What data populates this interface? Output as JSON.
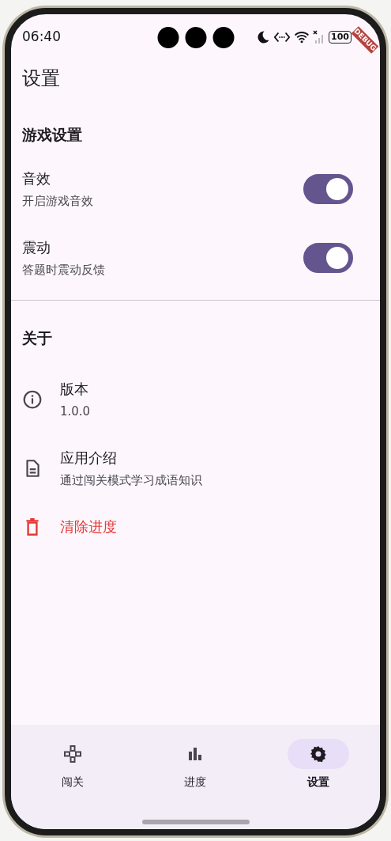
{
  "status_bar": {
    "time": "06:40",
    "battery": "100"
  },
  "debug_banner": "DEBUG",
  "app_bar": {
    "title": "设置"
  },
  "sections": [
    {
      "header": "游戏设置",
      "items": [
        {
          "kind": "switch",
          "title": "音效",
          "subtitle": "开启游戏音效",
          "on": true
        },
        {
          "kind": "switch",
          "title": "震动",
          "subtitle": "答题时震动反馈",
          "on": true
        }
      ]
    },
    {
      "header": "关于",
      "items": [
        {
          "kind": "info",
          "title": "版本",
          "subtitle": "1.0.0"
        },
        {
          "kind": "document",
          "title": "应用介绍",
          "subtitle": "通过闯关模式学习成语知识"
        },
        {
          "kind": "destructive",
          "title": "清除进度"
        }
      ]
    }
  ],
  "bottom_nav": [
    {
      "kind": "levels",
      "label": "闯关",
      "selected": false
    },
    {
      "kind": "progress",
      "label": "进度",
      "selected": false
    },
    {
      "kind": "settings",
      "label": "设置",
      "selected": true
    }
  ]
}
